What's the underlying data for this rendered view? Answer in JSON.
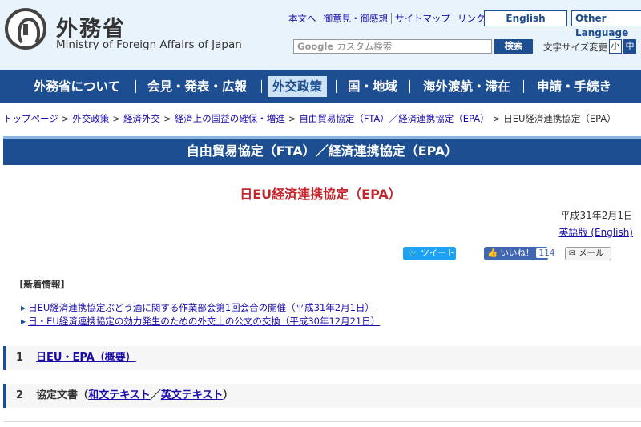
{
  "header": {
    "logo_ja": "外務省",
    "logo_en": "Ministry of Foreign Affairs of Japan",
    "util_links": [
      "本文へ",
      "御意見・御感想",
      "サイトマップ",
      "リンク集"
    ],
    "lang_english": "English",
    "lang_other": "Other Language",
    "search_prefix": "Google",
    "search_placeholder": "カスタム検索",
    "search_button": "検索",
    "fontsize_label": "文字サイズ変更",
    "fontsize_small": "小",
    "fontsize_mid": "中"
  },
  "nav": [
    "外務省について",
    "会見・発表・広報",
    "外交政策",
    "国・地域",
    "海外渡航・滞在",
    "申請・手続き"
  ],
  "nav_active": "外交政策",
  "breadcrumb": [
    "トップページ",
    "外交政策",
    "経済外交",
    "経済上の国益の確保・増進",
    "自由貿易協定（FTA）／経済連携協定（EPA）",
    "日EU経済連携協定（EPA）"
  ],
  "banner": "自由貿易協定（FTA）／経済連携協定（EPA）",
  "page_title": "日EU経済連携協定（EPA）",
  "date": "平成31年2月1日",
  "english_link": "英語版 (English)",
  "social": {
    "tweet": "ツイート",
    "like": "いいね！",
    "like_count": "114",
    "mail": "メール"
  },
  "news_heading": "【新着情報】",
  "news": [
    "日EU経済連携協定ぶどう酒に関する作業部会第1回会合の開催（平成31年2月1日）",
    "日・EU経済連携協定の効力発生のための外交上の公文の交換（平成30年12月21日）"
  ],
  "sections": {
    "s1_num": "1",
    "s1_link": "日EU・EPA（概要）",
    "s2_num": "2",
    "s2_prefix": "協定文書（",
    "s2_link_ja": "和文テキスト",
    "s2_slash": "／",
    "s2_link_en": "英文テキスト",
    "s2_suffix": "）"
  }
}
